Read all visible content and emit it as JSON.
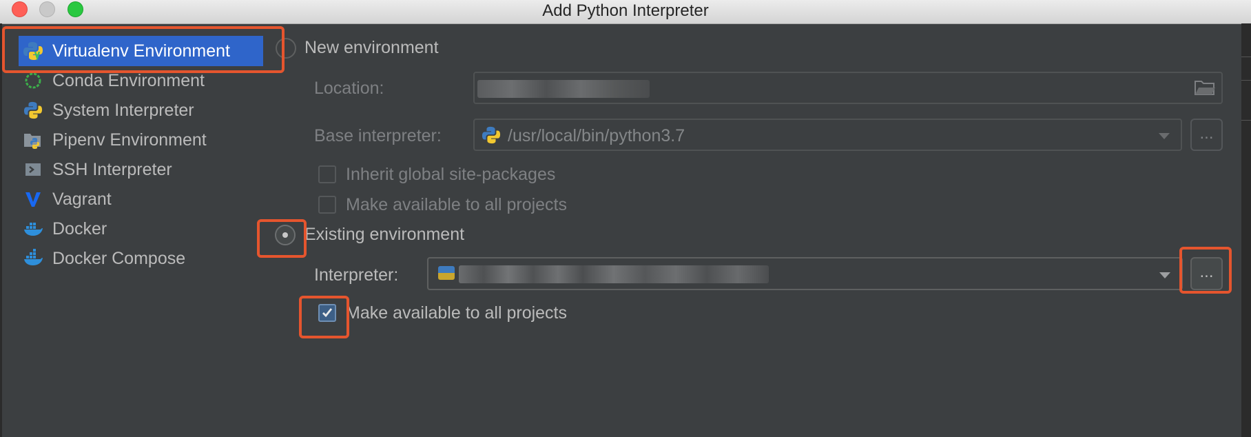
{
  "window": {
    "title": "Add Python Interpreter"
  },
  "sidebar": {
    "items": [
      {
        "label": "Virtualenv Environment",
        "icon": "python-virtualenv-icon",
        "selected": true
      },
      {
        "label": "Conda Environment",
        "icon": "conda-icon"
      },
      {
        "label": "System Interpreter",
        "icon": "python-icon"
      },
      {
        "label": "Pipenv Environment",
        "icon": "pipenv-icon"
      },
      {
        "label": "SSH Interpreter",
        "icon": "terminal-icon"
      },
      {
        "label": "Vagrant",
        "icon": "vagrant-icon"
      },
      {
        "label": "Docker",
        "icon": "docker-icon"
      },
      {
        "label": "Docker Compose",
        "icon": "docker-compose-icon"
      }
    ]
  },
  "new_env": {
    "radio_label": "New environment",
    "location_label": "Location:",
    "base_label": "Base interpreter:",
    "base_value": "/usr/local/bin/python3.7",
    "browse": "...",
    "inherit_label": "Inherit global site-packages",
    "make_available_label": "Make available to all projects"
  },
  "existing_env": {
    "radio_label": "Existing environment",
    "interpreter_label": "Interpreter:",
    "browse": "...",
    "make_available_label": "Make available to all projects",
    "make_available_checked": true
  },
  "colors": {
    "accent": "#2f65ca",
    "highlight": "#e5552e",
    "background": "#3c3f41"
  }
}
